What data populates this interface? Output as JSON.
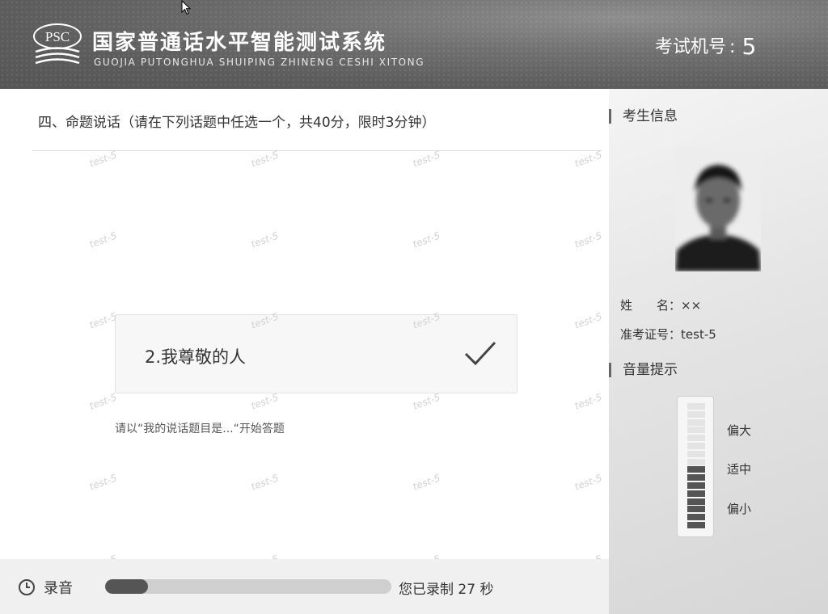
{
  "header": {
    "logo_text": "PSC",
    "title": "国家普通话水平智能测试系统",
    "subtitle": "GUOJIA PUTONGHUA SHUIPING ZHINENG CESHI XITONG",
    "exam_label": "考试机号",
    "exam_separator": ":",
    "exam_number": "5"
  },
  "question": {
    "title": "四、命题说话（请在下列话题中任选一个，共40分，限时3分钟）",
    "topic": "2.我尊敬的人",
    "hint": "请以“我的说话题目是...“开始答题"
  },
  "watermark_text": "test-5",
  "sidebar": {
    "candidate_title": "考生信息",
    "name_label": "姓　　名：",
    "name_value": "××",
    "id_label": "准考证号：",
    "id_value": "test-5",
    "volume_title": "音量提示",
    "volume_labels": {
      "high": "偏大",
      "mid": "适中",
      "low": "偏小"
    },
    "volume_level": 0.5
  },
  "recording": {
    "label": "录音",
    "progress": 0.15,
    "status_prefix": "您已录制",
    "seconds": "27",
    "status_suffix": "秒"
  },
  "colors": {
    "header_bg": "#666666",
    "accent": "#555555"
  },
  "icons": {
    "clock": "clock-icon",
    "check": "checkmark-icon",
    "cursor": "mouse-pointer-icon"
  }
}
